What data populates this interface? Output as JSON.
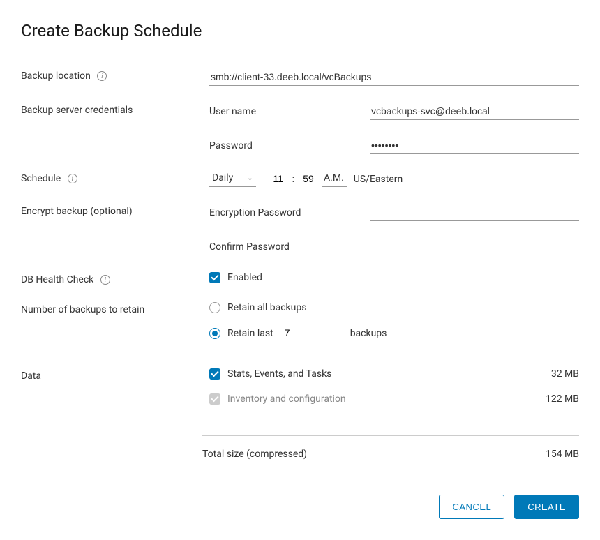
{
  "title": "Create Backup Schedule",
  "labels": {
    "backup_location": "Backup location",
    "backup_server_credentials": "Backup server credentials",
    "user_name": "User name",
    "password": "Password",
    "schedule": "Schedule",
    "encrypt_backup": "Encrypt backup (optional)",
    "encryption_password": "Encryption Password",
    "confirm_password": "Confirm Password",
    "db_health_check": "DB Health Check",
    "enabled": "Enabled",
    "num_backups_retain": "Number of backups to retain",
    "retain_all": "Retain all backups",
    "retain_last": "Retain last",
    "backups_suffix": "backups",
    "data": "Data",
    "stats_events_tasks": "Stats, Events, and Tasks",
    "inventory_config": "Inventory and configuration",
    "total_size": "Total size (compressed)"
  },
  "values": {
    "backup_location": "smb://client-33.deeb.local/vcBackups",
    "user_name": "vcbackups-svc@deeb.local",
    "password": "••••••••",
    "schedule_frequency": "Daily",
    "schedule_hour": "11",
    "schedule_minute": "59",
    "schedule_ampm": "A.M.",
    "schedule_timezone": "US/Eastern",
    "retain_count": "7",
    "stats_size": "32 MB",
    "inventory_size": "122 MB",
    "total_size": "154 MB"
  },
  "buttons": {
    "cancel": "CANCEL",
    "create": "CREATE"
  }
}
